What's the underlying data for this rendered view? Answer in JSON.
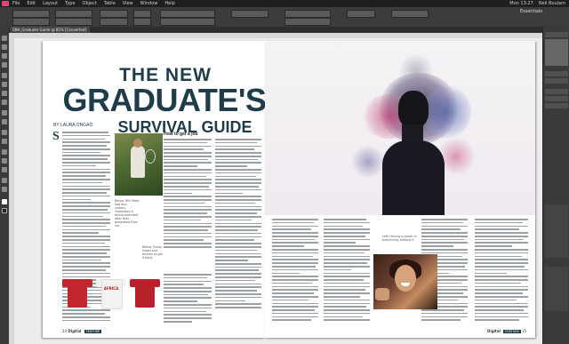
{
  "app": {
    "menu": [
      "File",
      "Edit",
      "Layout",
      "Type",
      "Object",
      "Table",
      "View",
      "Window",
      "Help"
    ],
    "workspace": "Essentials",
    "doc_tab": "SNH_Graduate Guide @ 85% [Converted]",
    "right_status": [
      "Mon 13:27",
      "Neil Boulam"
    ],
    "accent": "#e0457b"
  },
  "article": {
    "kicker": "THE NEW",
    "headline": "GRADUATE'S",
    "subhead": "SURVIVAL GUIDE",
    "byline": "BY LAURA ONGAO",
    "dropcap": "S",
    "section_head": "How to get a job",
    "caption_1": "Below: Will Yeats had four careers. Graduates in tennis attended after they graduated from uni.",
    "caption_2": "Below: Trains, hoops and fashion to get it done",
    "caption_3": "Left: Having a career in everything, without it",
    "tshirt_1": "",
    "tshirt_2": "AFRICA",
    "tshirt_3": "",
    "headline_color": "#1e3c4a"
  },
  "folio": {
    "left_num": "24",
    "left_mag": "Digital",
    "left_badge": "FEATURE",
    "right_mag": "Digital",
    "right_badge": "FEATURE",
    "right_num": "25"
  }
}
